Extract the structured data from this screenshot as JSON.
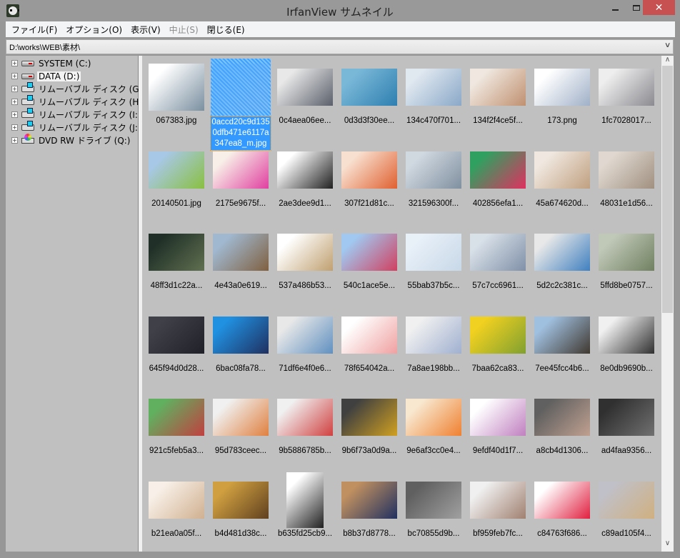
{
  "window": {
    "title": "IrfanView サムネイル",
    "close": "✕"
  },
  "menu": [
    {
      "label": "ファイル(F)",
      "disabled": false
    },
    {
      "label": "オプション(O)",
      "disabled": false
    },
    {
      "label": "表示(V)",
      "disabled": false
    },
    {
      "label": "中止(S)",
      "disabled": true
    },
    {
      "label": "閉じる(E)",
      "disabled": false
    }
  ],
  "address": {
    "path": "D:\\works\\WEB\\素材\\"
  },
  "tree": [
    {
      "label": "SYSTEM (C:)",
      "type": "hdd",
      "selected": false
    },
    {
      "label": "DATA (D:)",
      "type": "hdd",
      "selected": true
    },
    {
      "label": "リムーバブル ディスク (G:)",
      "type": "rem",
      "selected": false
    },
    {
      "label": "リムーバブル ディスク (H:)",
      "type": "rem",
      "selected": false
    },
    {
      "label": "リムーバブル ディスク (I:)",
      "type": "rem",
      "selected": false
    },
    {
      "label": "リムーバブル ディスク (J:)",
      "type": "rem",
      "selected": false
    },
    {
      "label": "DVD RW ドライブ (Q:)",
      "type": "dvd",
      "selected": false
    }
  ],
  "scroll": {
    "position_fraction": 0.0,
    "visible_fraction": 0.52
  },
  "thumbnails": [
    {
      "name": "067383.jpg",
      "c": [
        "#ffffff",
        "#7a8fa0"
      ],
      "shape": "sq"
    },
    {
      "name": "0accd20c9d1350dfb471e6117a347ea8_m.jpg",
      "c": [
        "#4ea8ff",
        "#7fb0e0"
      ],
      "shape": "sq",
      "selected": true
    },
    {
      "name": "0c4aea06ee...",
      "c": [
        "#e8e8e8",
        "#5a5f6a"
      ]
    },
    {
      "name": "0d3d3f30ee...",
      "c": [
        "#7ab8d8",
        "#2e7fb0"
      ]
    },
    {
      "name": "134c470f701...",
      "c": [
        "#e0e8f0",
        "#8aa8c8"
      ]
    },
    {
      "name": "134f2f4ce5f...",
      "c": [
        "#f0e8e0",
        "#c09070"
      ]
    },
    {
      "name": "173.png",
      "c": [
        "#ffffff",
        "#a0b0c8"
      ]
    },
    {
      "name": "1fc7028017...",
      "c": [
        "#eeeeee",
        "#8a8a90"
      ]
    },
    {
      "name": "20140501.jpg",
      "c": [
        "#a8c8e8",
        "#8ac040"
      ]
    },
    {
      "name": "2175e9675f...",
      "c": [
        "#f8f0e8",
        "#e040a0"
      ]
    },
    {
      "name": "2ae3dee9d1...",
      "c": [
        "#ffffff",
        "#202020"
      ]
    },
    {
      "name": "307f21d81c...",
      "c": [
        "#f8e0d0",
        "#e06030"
      ]
    },
    {
      "name": "321596300f...",
      "c": [
        "#d0d8e0",
        "#8090a0"
      ]
    },
    {
      "name": "402856efa1...",
      "c": [
        "#30a060",
        "#e03060"
      ]
    },
    {
      "name": "45a674620d...",
      "c": [
        "#f0e8e0",
        "#c0a080"
      ]
    },
    {
      "name": "48031e1d56...",
      "c": [
        "#e0d8d0",
        "#a09080"
      ]
    },
    {
      "name": "48ff3d1c22a...",
      "c": [
        "#203028",
        "#607050"
      ]
    },
    {
      "name": "4e43a0e619...",
      "c": [
        "#a0b8d0",
        "#806040"
      ]
    },
    {
      "name": "537a486b53...",
      "c": [
        "#ffffff",
        "#c0a070"
      ]
    },
    {
      "name": "540c1ace5e...",
      "c": [
        "#a0c8f0",
        "#d04060"
      ]
    },
    {
      "name": "55bab37b5c...",
      "c": [
        "#e8f0f8",
        "#c8d8e8"
      ]
    },
    {
      "name": "57c7cc6961...",
      "c": [
        "#d8e0e8",
        "#8090a8"
      ]
    },
    {
      "name": "5d2c2c381c...",
      "c": [
        "#e8e8e8",
        "#4080c0"
      ]
    },
    {
      "name": "5ffd8be0757...",
      "c": [
        "#c0c8b8",
        "#708060"
      ]
    },
    {
      "name": "645f94d0d28...",
      "c": [
        "#404048",
        "#202028"
      ]
    },
    {
      "name": "6bac08fa78...",
      "c": [
        "#2090e0",
        "#203060"
      ]
    },
    {
      "name": "71df6e4f0e6...",
      "c": [
        "#e8e8e8",
        "#6090c0"
      ]
    },
    {
      "name": "78f654042a...",
      "c": [
        "#ffffff",
        "#f0a0a0"
      ]
    },
    {
      "name": "7a8ae198bb...",
      "c": [
        "#f0f0f0",
        "#a0b0d0"
      ]
    },
    {
      "name": "7baa62ca83...",
      "c": [
        "#f0d020",
        "#80a030"
      ]
    },
    {
      "name": "7ee45fcc4b6...",
      "c": [
        "#a0c0e0",
        "#403830"
      ]
    },
    {
      "name": "8e0db9690b...",
      "c": [
        "#f0f0f0",
        "#303030"
      ]
    },
    {
      "name": "921c5feb5a3...",
      "c": [
        "#60b060",
        "#c04040"
      ]
    },
    {
      "name": "95d783ceec...",
      "c": [
        "#f0f0f0",
        "#e08040"
      ]
    },
    {
      "name": "9b5886785b...",
      "c": [
        "#f0f0f0",
        "#d04040"
      ]
    },
    {
      "name": "9b6f73a0d9a...",
      "c": [
        "#404040",
        "#d0a020"
      ]
    },
    {
      "name": "9e6af3cc0e4...",
      "c": [
        "#f8e8d0",
        "#f08030"
      ]
    },
    {
      "name": "9efdf40d1f7...",
      "c": [
        "#ffffff",
        "#c080c0"
      ]
    },
    {
      "name": "a8cb4d1306...",
      "c": [
        "#606060",
        "#c0a090"
      ]
    },
    {
      "name": "ad4faa9356...",
      "c": [
        "#303030",
        "#707070"
      ]
    },
    {
      "name": "b21ea0a05f...",
      "c": [
        "#f8f0e8",
        "#d0b090"
      ]
    },
    {
      "name": "b4d481d38c...",
      "c": [
        "#d0a040",
        "#604020"
      ]
    },
    {
      "name": "b635fd25cb9...",
      "c": [
        "#ffffff",
        "#202020"
      ],
      "shape": "port"
    },
    {
      "name": "b8b37d8778...",
      "c": [
        "#c09060",
        "#203060"
      ]
    },
    {
      "name": "bc70855d9b...",
      "c": [
        "#606060",
        "#a0a0a0"
      ]
    },
    {
      "name": "bf959feb7fc...",
      "c": [
        "#f0f0f0",
        "#a08070"
      ]
    },
    {
      "name": "c84763f686...",
      "c": [
        "#ffffff",
        "#e02040"
      ]
    },
    {
      "name": "c89ad105f4...",
      "c": [
        "#c0c0c8",
        "#d0b080"
      ]
    }
  ]
}
